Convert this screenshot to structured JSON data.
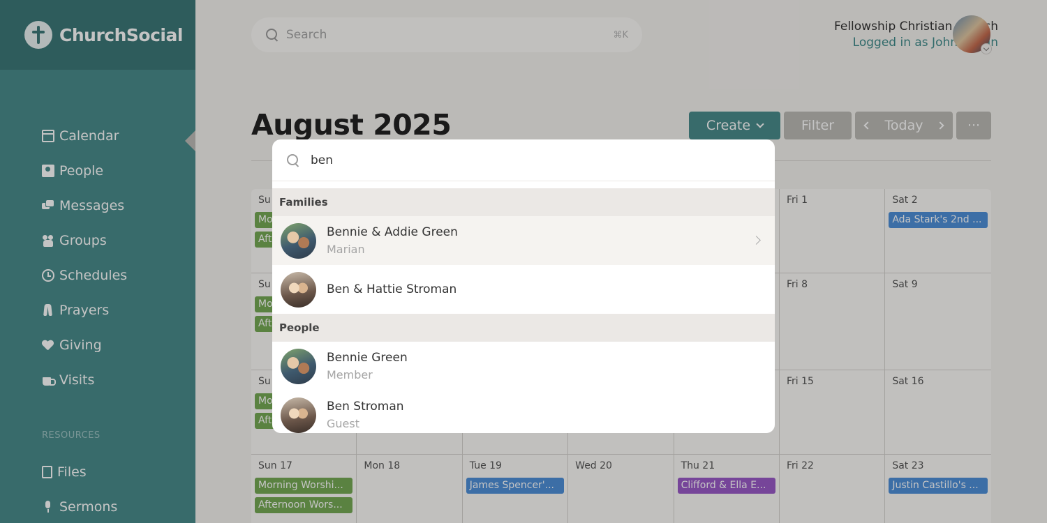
{
  "app": {
    "name": "ChurchSocial"
  },
  "sidebar": {
    "items": [
      {
        "label": "Calendar",
        "icon": "calendar-icon"
      },
      {
        "label": "People",
        "icon": "people-icon"
      },
      {
        "label": "Messages",
        "icon": "messages-icon"
      },
      {
        "label": "Groups",
        "icon": "groups-icon"
      },
      {
        "label": "Schedules",
        "icon": "clock-icon"
      },
      {
        "label": "Prayers",
        "icon": "prayer-icon"
      },
      {
        "label": "Giving",
        "icon": "heart-icon"
      },
      {
        "label": "Visits",
        "icon": "coffee-icon"
      }
    ],
    "resources_label": "RESOURCES",
    "resources": [
      {
        "label": "Files",
        "icon": "file-icon"
      },
      {
        "label": "Sermons",
        "icon": "microphone-icon"
      }
    ]
  },
  "header": {
    "search_placeholder": "Search",
    "search_shortcut": "⌘K",
    "org_name": "Fellowship Christian Church",
    "logged_in": "Logged in as John Calvin"
  },
  "page": {
    "title": "August 2025",
    "create_label": "Create",
    "filter_label": "Filter",
    "today_label": "Today",
    "more_label": "···"
  },
  "calendar": {
    "weeks": [
      {
        "days": [
          {
            "label": "Su",
            "events": [
              {
                "text": "Mo",
                "color": "green"
              },
              {
                "text": "Aft",
                "color": "green"
              }
            ]
          },
          {
            "label": "",
            "events": []
          },
          {
            "label": "",
            "events": []
          },
          {
            "label": "",
            "events": []
          },
          {
            "label": "",
            "events": []
          },
          {
            "label": "Fri 1",
            "events": []
          },
          {
            "label": "Sat 2",
            "events": [
              {
                "text": "Ada Stark's 2nd ...",
                "color": "blue"
              }
            ]
          }
        ]
      },
      {
        "days": [
          {
            "label": "Su",
            "events": [
              {
                "text": "Mo",
                "color": "green"
              },
              {
                "text": "Aft",
                "color": "green"
              }
            ]
          },
          {
            "label": "",
            "events": []
          },
          {
            "label": "",
            "events": []
          },
          {
            "label": "",
            "events": []
          },
          {
            "label": "",
            "events": []
          },
          {
            "label": "Fri 8",
            "events": []
          },
          {
            "label": "Sat 9",
            "events": []
          }
        ]
      },
      {
        "days": [
          {
            "label": "Su",
            "events": [
              {
                "text": "Mo",
                "color": "green"
              },
              {
                "text": "Aft",
                "color": "green"
              }
            ]
          },
          {
            "label": "",
            "events": []
          },
          {
            "label": "",
            "events": []
          },
          {
            "label": "",
            "events": []
          },
          {
            "label": "",
            "events": []
          },
          {
            "label": "Fri 15",
            "events": []
          },
          {
            "label": "Sat 16",
            "events": []
          }
        ]
      },
      {
        "days": [
          {
            "label": "Sun 17",
            "events": [
              {
                "text": "Morning Worshi...",
                "color": "green"
              },
              {
                "text": "Afternoon Wors...",
                "color": "green"
              }
            ]
          },
          {
            "label": "Mon 18",
            "events": []
          },
          {
            "label": "Tue 19",
            "events": [
              {
                "text": "James Spencer'...",
                "color": "blue"
              }
            ]
          },
          {
            "label": "Wed 20",
            "events": []
          },
          {
            "label": "Thu 21",
            "events": [
              {
                "text": "Clifford & Ella E...",
                "color": "purple"
              }
            ]
          },
          {
            "label": "Fri 22",
            "events": []
          },
          {
            "label": "Sat 23",
            "events": [
              {
                "text": "Justin Castillo's ...",
                "color": "blue"
              }
            ]
          }
        ]
      }
    ]
  },
  "search_modal": {
    "query": "ben",
    "families_label": "Families",
    "people_label": "People",
    "families": [
      {
        "name": "Bennie & Addie Green",
        "sub": "Marian"
      },
      {
        "name": "Ben & Hattie Stroman",
        "sub": ""
      }
    ],
    "people": [
      {
        "name": "Bennie Green",
        "sub": "Member"
      },
      {
        "name": "Ben Stroman",
        "sub": "Guest"
      }
    ]
  },
  "colors": {
    "sidebar": "#4a8c8c",
    "brand_bar": "#3d7878",
    "accent": "#4a8c8c",
    "event_green": "#76a955",
    "event_blue": "#4f8fd8",
    "event_purple": "#9a5ac8"
  }
}
